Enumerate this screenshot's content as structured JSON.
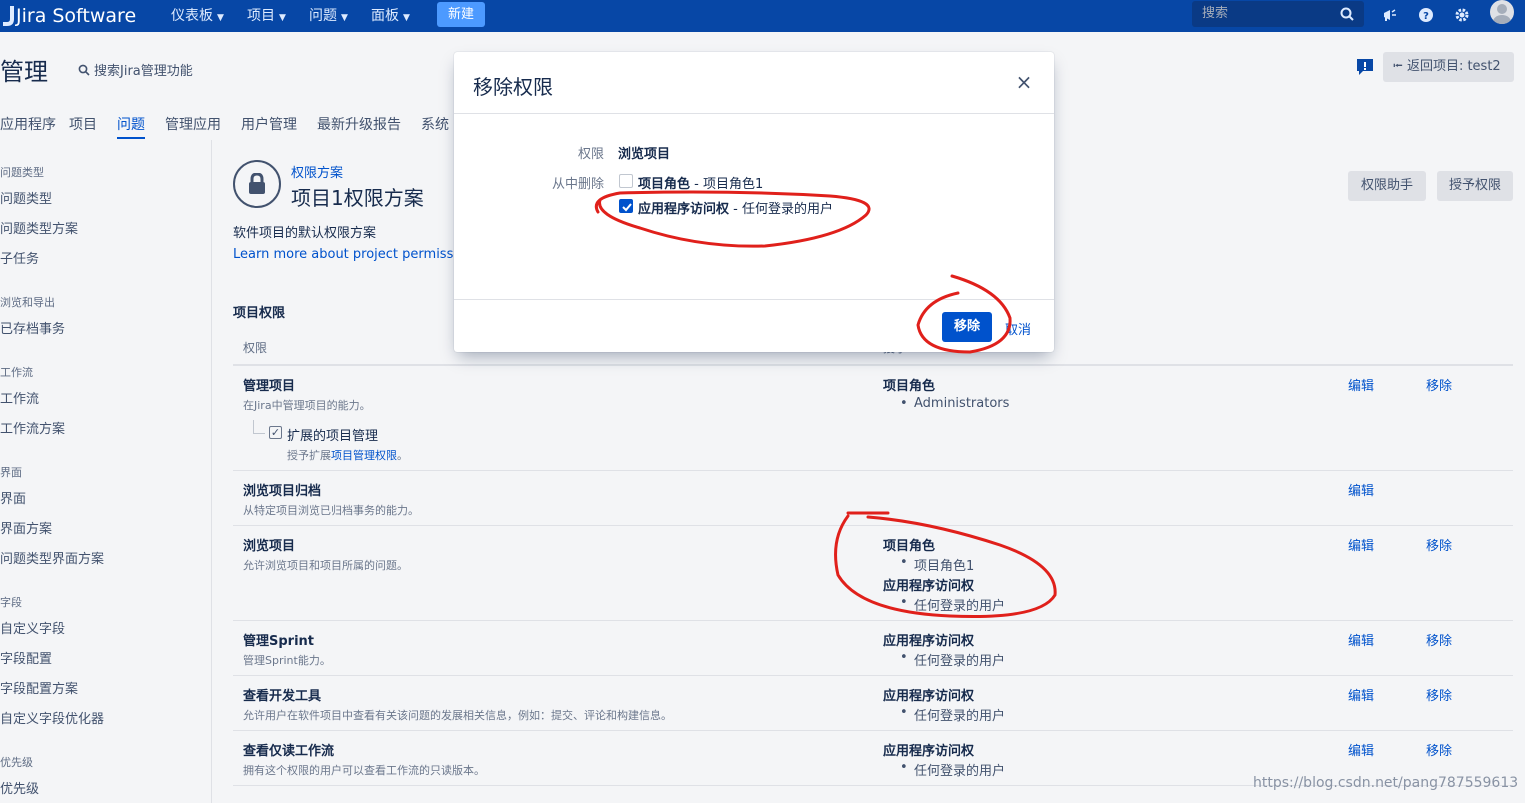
{
  "topnav": {
    "brand": "Jira Software",
    "items": [
      "仪表板",
      "项目",
      "问题",
      "面板"
    ],
    "create_label": "新建",
    "search_placeholder": "搜索",
    "colors": {
      "bar": "#0747a6",
      "create": "#4c9aff"
    }
  },
  "admin": {
    "title": "管理",
    "search_label": "搜索Jira管理功能",
    "back_label": "返回项目: test2",
    "tabs": [
      "应用程序",
      "项目",
      "问题",
      "管理应用",
      "用户管理",
      "最新升级报告",
      "系统"
    ],
    "active_tab": "问题"
  },
  "sidebar": {
    "groups": [
      {
        "section": "问题类型",
        "items": [
          "问题类型",
          "问题类型方案",
          "子任务"
        ]
      },
      {
        "section": "浏览和导出",
        "items": [
          "已存档事务"
        ]
      },
      {
        "section": "工作流",
        "items": [
          "工作流",
          "工作流方案"
        ]
      },
      {
        "section": "界面",
        "items": [
          "界面",
          "界面方案",
          "问题类型界面方案"
        ]
      },
      {
        "section": "字段",
        "items": [
          "自定义字段",
          "字段配置",
          "字段配置方案",
          "自定义字段优化器"
        ]
      },
      {
        "section": "优先级",
        "items": [
          "优先级"
        ]
      }
    ]
  },
  "scheme": {
    "crumb": "权限方案",
    "title": "项目1权限方案",
    "description": "软件项目的默认权限方案",
    "learn_more": "Learn more about project permissions",
    "helper_button": "权限助手",
    "grant_button": "授予权限",
    "section_title": "项目权限",
    "col_permission": "权限",
    "col_granted": "授予",
    "rows": [
      {
        "name": "管理项目",
        "desc": "在Jira中管理项目的能力。",
        "grants": [
          {
            "head": "项目角色",
            "items": [
              "Administrators"
            ]
          }
        ],
        "edit": "编辑",
        "remove": "移除",
        "extended": {
          "label": "扩展的项目管理",
          "desc_prefix": "授予扩展",
          "desc_link": "项目管理权限",
          "desc_suffix": "。"
        }
      },
      {
        "name": "浏览项目归档",
        "desc": "从特定项目浏览已归档事务的能力。",
        "grants": [],
        "edit": "编辑",
        "remove": ""
      },
      {
        "name": "浏览项目",
        "desc": "允许浏览项目和项目所属的问题。",
        "grants": [
          {
            "head": "项目角色",
            "items": [
              "项目角色1"
            ]
          },
          {
            "head": "应用程序访问权",
            "items": [
              "任何登录的用户"
            ]
          }
        ],
        "edit": "编辑",
        "remove": "移除"
      },
      {
        "name": "管理Sprint",
        "desc": "管理Sprint能力。",
        "grants": [
          {
            "head": "应用程序访问权",
            "items": [
              "任何登录的用户"
            ]
          }
        ],
        "edit": "编辑",
        "remove": "移除"
      },
      {
        "name": "查看开发工具",
        "desc": "允许用户在软件项目中查看有关该问题的发展相关信息，例如：提交、评论和构建信息。",
        "grants": [
          {
            "head": "应用程序访问权",
            "items": [
              "任何登录的用户"
            ]
          }
        ],
        "edit": "编辑",
        "remove": "移除"
      },
      {
        "name": "查看仅读工作流",
        "desc": "拥有这个权限的用户可以查看工作流的只读版本。",
        "grants": [
          {
            "head": "应用程序访问权",
            "items": [
              "任何登录的用户"
            ]
          }
        ],
        "edit": "编辑",
        "remove": "移除"
      }
    ]
  },
  "dialog": {
    "title": "移除权限",
    "close_glyph": "×",
    "perm_label": "权限",
    "perm_value": "浏览项目",
    "remove_from_label": "从中删除",
    "options": [
      {
        "bold": "项目角色",
        "rest": " - 项目角色1",
        "checked": false
      },
      {
        "bold": "应用程序访问权",
        "rest": " - 任何登录的用户",
        "checked": true
      }
    ],
    "remove_button": "移除",
    "cancel_link": "取消"
  },
  "watermark": "https://blog.csdn.net/pang787559613",
  "colors": {
    "link": "#0052cc",
    "annotation": "#e0201b"
  }
}
